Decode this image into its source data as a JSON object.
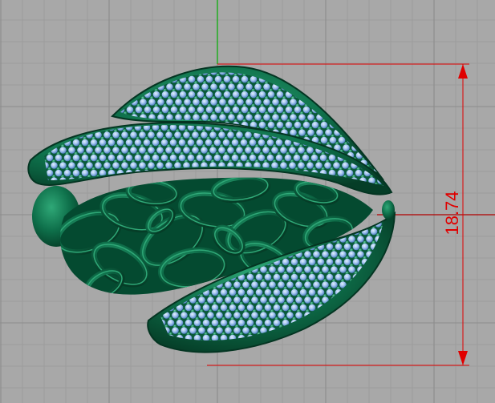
{
  "viewport": {
    "background_color": "#a8a8a8",
    "grid_minor_color": "#9a9a9a",
    "grid_major_color": "#8c8c8c",
    "y_axis_color": "#00b000",
    "x_axis_color": "#b00000"
  },
  "model": {
    "icon": "pendant-3d-model-icon",
    "metal_color": "#0e6f4a",
    "metal_dark_color": "#053d27",
    "metal_light_color": "#2fa877",
    "gem_color": "#9ec1ee",
    "gem_dark_color": "#4d7ac0"
  },
  "dimension": {
    "value_text": "18.74",
    "color": "#e00000"
  }
}
